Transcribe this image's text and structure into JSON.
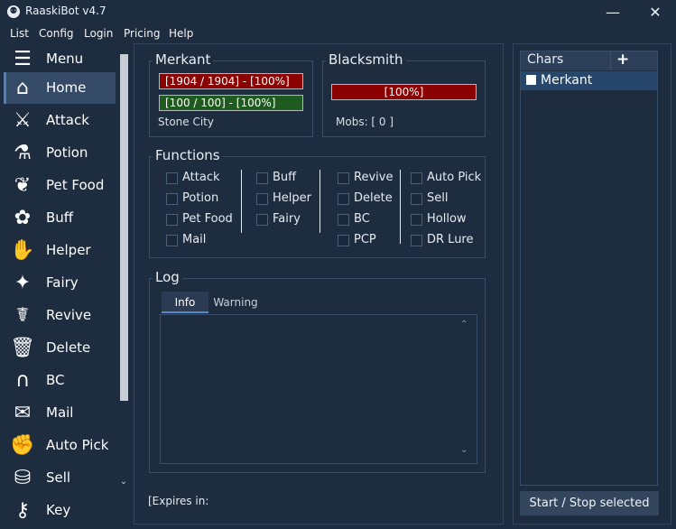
{
  "app": {
    "title": "RaaskiBot v4.7",
    "icon_glyph": "⚉"
  },
  "window_controls": {
    "minimize": "—",
    "close": "✕"
  },
  "menubar": {
    "items": [
      "List",
      "Config",
      "Login",
      "Pricing",
      "Help"
    ]
  },
  "sidebar": {
    "items": [
      {
        "label": "Menu",
        "icon": "☰",
        "icon_name": "hamburger-icon"
      },
      {
        "label": "Home",
        "icon": "⌂",
        "icon_name": "home-icon",
        "active": true
      },
      {
        "label": "Attack",
        "icon": "⚔",
        "icon_name": "sword-icon"
      },
      {
        "label": "Potion",
        "icon": "⚗",
        "icon_name": "potion-icon"
      },
      {
        "label": "Pet Food",
        "icon": "❦",
        "icon_name": "pear-icon"
      },
      {
        "label": "Buff",
        "icon": "✿",
        "icon_name": "buff-icon"
      },
      {
        "label": "Helper",
        "icon": "✋",
        "icon_name": "handshake-icon"
      },
      {
        "label": "Fairy",
        "icon": "✦",
        "icon_name": "fairy-icon"
      },
      {
        "label": "Revive",
        "icon": "☤",
        "icon_name": "caduceus-icon"
      },
      {
        "label": "Delete",
        "icon": "🗑",
        "icon_name": "trash-icon"
      },
      {
        "label": "BC",
        "icon": "∩",
        "icon_name": "arch-icon"
      },
      {
        "label": "Mail",
        "icon": "✉",
        "icon_name": "mail-icon"
      },
      {
        "label": "Auto Pick",
        "icon": "✊",
        "icon_name": "grab-hand-icon"
      },
      {
        "label": "Sell",
        "icon": "⛁",
        "icon_name": "coins-icon"
      },
      {
        "label": "Key",
        "icon": "⚷",
        "icon_name": "key-icon"
      }
    ],
    "scroll_down_glyph": "⌄"
  },
  "merkant": {
    "title": "Merkant",
    "hp": "[1904 / 1904] - [100%]",
    "mp": "[100 / 100] - [100%]",
    "location": "Stone City",
    "hp_fraction": 1.0,
    "mp_fraction": 1.0
  },
  "blacksmith": {
    "title": "Blacksmith",
    "bar": "[100%]",
    "mobs": "Mobs:  [ 0 ]"
  },
  "functions": {
    "title": "Functions",
    "columns": [
      [
        "Attack",
        "Potion",
        "Pet Food",
        "Mail"
      ],
      [
        "Buff",
        "Helper",
        "Fairy"
      ],
      [
        "Revive",
        "Delete",
        "BC",
        "PCP"
      ],
      [
        "Auto Pick",
        "Sell",
        "Hollow",
        "DR Lure"
      ]
    ]
  },
  "log": {
    "title": "Log",
    "tabs": [
      {
        "label": "Info",
        "active": true
      },
      {
        "label": "Warning",
        "active": false
      }
    ],
    "scroll_up": "⌃",
    "scroll_down": "⌄"
  },
  "footer": {
    "expires": "[Expires in:"
  },
  "chars": {
    "title": "Chars",
    "add": "+",
    "list": [
      "Merkant"
    ]
  },
  "start_stop_label": "Start / Stop selected",
  "colors": {
    "background": "#1e2c40",
    "hp_bar": "#8b0000",
    "mp_bar": "#1f5a1f",
    "selected_row": "#26466c"
  }
}
